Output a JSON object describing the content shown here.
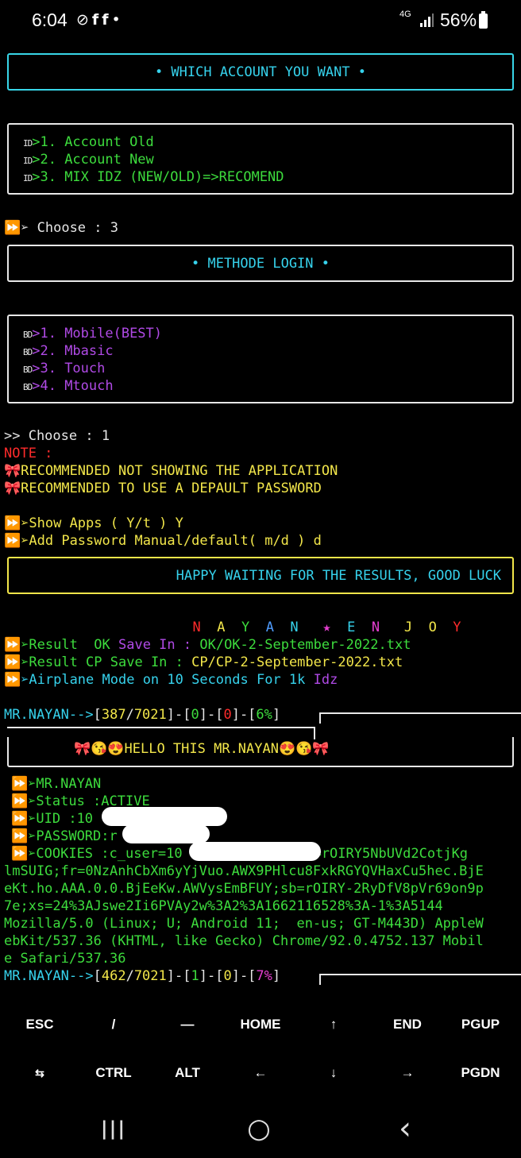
{
  "status_bar": {
    "time": "6:04",
    "notification_icons": [
      "sync-off-icon",
      "facebook-icon",
      "facebook-icon",
      "dot-icon"
    ],
    "network": "4G",
    "battery_percent": "56%"
  },
  "header_box": {
    "text": "• WHICH ACCOUNT YOU WANT •"
  },
  "account_menu": {
    "items": [
      {
        "prefix": "ID",
        "label": ">1. Account Old"
      },
      {
        "prefix": "ID",
        "label": ">2. Account New"
      },
      {
        "prefix": "ID",
        "label": ">3. MIX IDZ (NEW/OLD)=>RECOMEND"
      }
    ]
  },
  "choose_1": {
    "prompt": "⏩➢ Choose : ",
    "value": "3"
  },
  "login_box": {
    "text": "• METHODE LOGIN •"
  },
  "login_menu": {
    "items": [
      {
        "prefix": "BD",
        "label": ">1. Mobile(BEST)"
      },
      {
        "prefix": "BD",
        "label": ">2. Mbasic"
      },
      {
        "prefix": "BD",
        "label": ">3. Touch"
      },
      {
        "prefix": "BD",
        "label": ">4. Mtouch"
      }
    ]
  },
  "choose_2": {
    "prompt": ">> Choose : ",
    "value": "1"
  },
  "note": {
    "label": "NOTE :",
    "lines": [
      "🎀RECOMMENDED NOT SHOWING THE APPLICATION",
      "🎀RECOMMENDED TO USE A DEPAULT PASSWORD"
    ]
  },
  "prompts": {
    "show_apps": "⏩➢Show Apps ( Y/t ) Y",
    "add_password": "⏩➢Add Password Manual/default( m/d ) d"
  },
  "wait_box": {
    "text": "HAPPY WAITING FOR THE RESULTS, GOOD LUCK"
  },
  "banner": {
    "letters": [
      "N",
      "A",
      "Y",
      "A",
      "N",
      "★",
      "E",
      "N",
      "J",
      "O",
      "Y"
    ]
  },
  "results": {
    "ok": {
      "prefix": "⏩➢Result  OK ",
      "save_in": "Save In : ",
      "path": "OK/OK-2-September-2022.txt"
    },
    "cp": {
      "prefix": "⏩➢Result CP ",
      "save_in": "Save In : ",
      "path": "CP/CP-2-September-2022.txt"
    },
    "airplane": {
      "text": "⏩➢Airplane Mode on 10 Seconds For 1k ",
      "tail": "Idz"
    }
  },
  "progress_1": {
    "name": "MR.NAYAN-->",
    "count": "387",
    "total": "7021",
    "ok": "0",
    "cp": "0",
    "percent": "6%"
  },
  "hello_box": {
    "text": "🎀😘😍HELLO THIS MR.NAYAN😍😘🎀"
  },
  "account_info": {
    "name": "⏩➢MR.NAYAN",
    "status": "⏩➢Status :ACTIVE",
    "uid": "⏩➢UID :10",
    "password": "⏩➢PASSWORD:r",
    "cookies_label": "⏩➢COOKIES :c_user=10",
    "cookies_rest": "datr=rOIRY5NbUVd2CotjKg",
    "cookie_lines": [
      "lmSUIG;fr=0NzAnhCbXm6yYjVuo.AWX9PHlcu8FxkRGYQVHaxCu5hec.BjE",
      "eKt.ho.AAA.0.0.BjEeKw.AWVysEmBFUY;sb=rOIRY-2RyDfV8pVr69on9p",
      "7e;xs=24%3AJswe2Ii6PVAy2w%3A2%3A1662116528%3A-1%3A5144",
      "Mozilla/5.0 (Linux; U; Android 11;  en-us; GT-M443D) AppleW",
      "ebKit/537.36 (KHTML, like Gecko) Chrome/92.0.4752.137 Mobil",
      "e Safari/537.36"
    ]
  },
  "progress_2": {
    "name": "MR.NAYAN-->",
    "count": "462",
    "total": "7021",
    "ok": "1",
    "cp": "0",
    "percent": "7%"
  },
  "extra_keys": {
    "row1": [
      "ESC",
      "/",
      "—",
      "HOME",
      "↑",
      "END",
      "PGUP"
    ],
    "row2": [
      "⇆",
      "CTRL",
      "ALT",
      "←",
      "↓",
      "→",
      "PGDN"
    ]
  },
  "nav_bar": {
    "recents": "|||",
    "home": "○",
    "back": "‹"
  }
}
